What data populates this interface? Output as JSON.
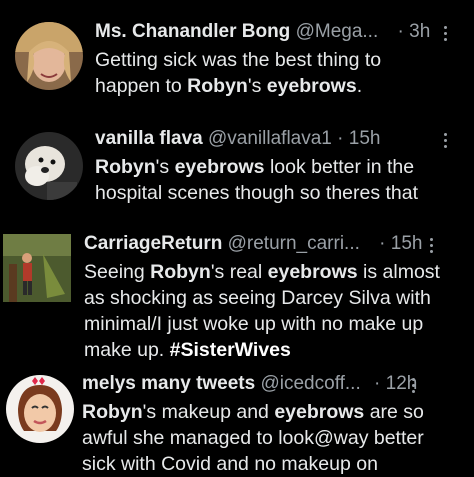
{
  "tweets": [
    {
      "name": "Ms. Chanandler Bong",
      "handle": "@Mega...",
      "time": "3h",
      "text_parts": [
        "Getting sick was the best thing to happen to ",
        "Robyn",
        "'s ",
        "eyebrows",
        "."
      ]
    },
    {
      "name": "vanilla flava",
      "handle": "@vanillaflava1",
      "time": "15h",
      "text_parts": [
        "Robyn",
        "'s ",
        "eyebrows",
        " look better in the hospital scenes though so theres that"
      ]
    },
    {
      "name": "CarriageReturn",
      "handle": "@return_carri...",
      "time": "15h",
      "text_parts": [
        "Seeing ",
        "Robyn",
        "'s real ",
        "eyebrows",
        " is almost as shocking as seeing Darcey Silva with minimal/I just woke up with no make up make up. ",
        "#SisterWives"
      ]
    },
    {
      "name": "melys many tweets",
      "handle": "@icedcoff...",
      "time": "12h",
      "text_parts": [
        "Robyn",
        "'s makeup and ",
        "eyebrows",
        " are so awful she managed to look@way better sick with Covid and no makeup on"
      ]
    }
  ],
  "separator": "·",
  "icons": [
    "avatar-photo",
    "menu-dots-icon"
  ]
}
